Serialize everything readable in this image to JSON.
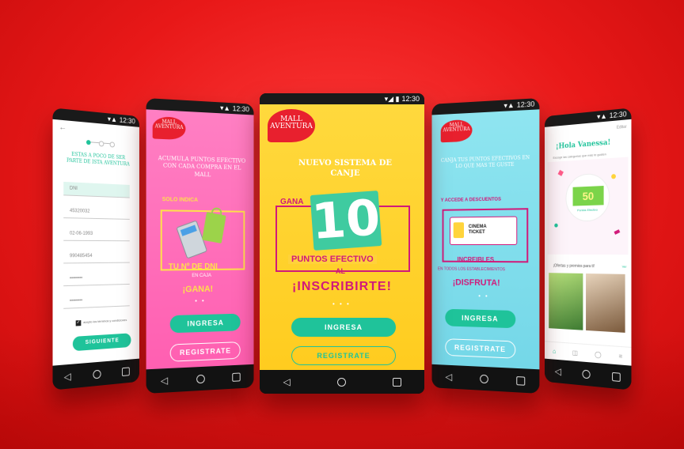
{
  "status_time": "12:30",
  "logo": {
    "line1": "MALL",
    "line2": "AVENTURA"
  },
  "phone1": {
    "title": "ESTAS A POCO DE SER PARTE DE ISTA AVENTURA",
    "fields": [
      "DNI",
      "45320032",
      "02-06-1993",
      "990485454",
      "••••••••",
      "••••••••"
    ],
    "checkbox_label": "acepto los términos y condiciones",
    "submit": "SIGUIENTE"
  },
  "phone2": {
    "headline": "ACUMULA PUNTOS EFECTIVO CON CADA COMPRA EN EL MALL",
    "solo": "SOLO INDICA",
    "dni": "TU Nº DE DNI",
    "caja": "EN CAJA",
    "gana": "¡GANA!",
    "ingresa": "INGRESA",
    "registrate": "REGISTRATE"
  },
  "phone3": {
    "headline": "NUEVO SISTEMA DE CANJE",
    "gana": "GANA",
    "big": "10",
    "puntos": "PUNTOS EFECTIVO",
    "al": "AL",
    "inscribirte": "¡INSCRIBIRTE!",
    "dots": "• • •",
    "ingresa": "INGRESA",
    "registrate": "REGISTRATE"
  },
  "phone4": {
    "headline": "CANJA TUS PUNTOS EFECTIVOS EN LO QUE MAS TE GUSTE",
    "accede": "Y ACCEDE A DESCUENTOS",
    "ticket": "CINEMA TICKET",
    "increibles": "INCREIBLES",
    "establecimientos": "EN TODOS LOS ESTABLECIMIENTOS",
    "disfruta": "¡DISFRUTA!",
    "ingresa": "INGRESA",
    "registrate": "REGISTRATE"
  },
  "phone5": {
    "greeting": "¡Hola Vanessa!",
    "edit": "Editar",
    "subtitle": "Escoge las categorías que más te gusten",
    "points": "50",
    "points_label": "Puntos Efectivo",
    "offers": "¡Ofertas y premios para ti!",
    "ver": "Ver"
  }
}
